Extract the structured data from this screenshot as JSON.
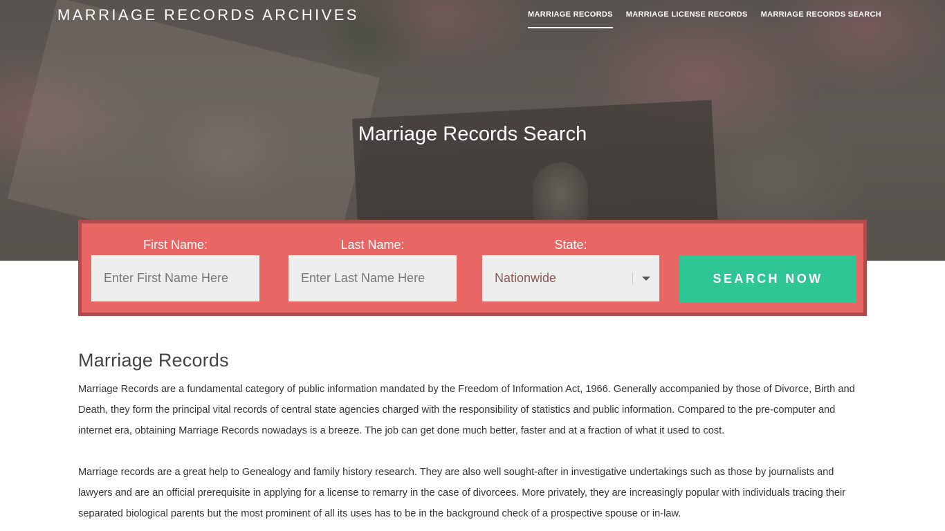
{
  "header": {
    "brand": "MARRIAGE RECORDS ARCHIVES",
    "nav": [
      {
        "label": "MARRIAGE RECORDS",
        "active": true
      },
      {
        "label": "MARRIAGE LICENSE RECORDS",
        "active": false
      },
      {
        "label": "MARRIAGE RECORDS SEARCH",
        "active": false
      }
    ]
  },
  "hero": {
    "title": "Marriage Records Search"
  },
  "search": {
    "first_name_label": "First Name:",
    "first_name_placeholder": "Enter First Name Here",
    "last_name_label": "Last Name:",
    "last_name_placeholder": "Enter Last Name Here",
    "state_label": "State:",
    "state_selected": "Nationwide",
    "button_label": "SEARCH NOW"
  },
  "main": {
    "heading": "Marriage Records",
    "paragraphs": [
      "Marriage Records are a fundamental category of public information mandated by the Freedom of Information Act, 1966. Generally accompanied by those of Divorce, Birth and Death, they form the principal vital records of central state agencies charged with the responsibility of statistics and public information. Compared to the pre-computer and internet era, obtaining Marriage Records nowadays is a breeze. The job can get done much better, faster and at a fraction of what it used to cost.",
      "Marriage records are a great help to Genealogy and family history research. They are also well sought-after in investigative undertakings such as those by journalists and lawyers and are an official prerequisite in applying for a license to remarry in the case of divorcees. More privately, they are increasingly popular with individuals tracing their separated biological parents but the most prominent of all its uses has to be in the background check of a prospective spouse or in-law."
    ]
  },
  "colors": {
    "search_panel": "#e86664",
    "search_panel_border": "#b14b4b",
    "button": "#2ec695",
    "input_bg": "#eeeeee"
  },
  "icons": {
    "state_dropdown": "caret-down-icon"
  }
}
